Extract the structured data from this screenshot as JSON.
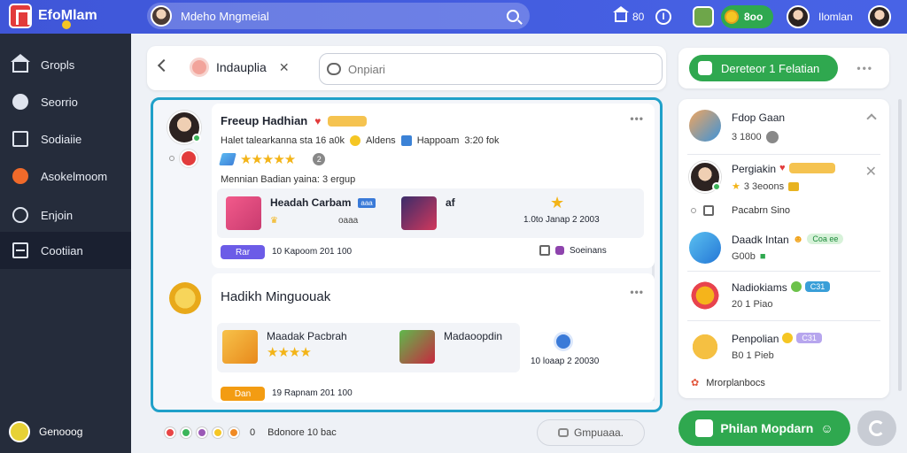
{
  "app": {
    "name": "EfoMlam"
  },
  "topbar": {
    "search_text": "Mdeho Mngmeial",
    "nav_label": "80",
    "info_label": "I",
    "coins_label": "8oo",
    "user_name": "Ilomlan"
  },
  "sidebar": {
    "items": [
      {
        "label": "Gropls",
        "icon": "home-icon"
      },
      {
        "label": "Seorrio",
        "icon": "face-icon"
      },
      {
        "label": "Sodiaiie",
        "icon": "board-icon"
      },
      {
        "label": "Asokelmoom",
        "icon": "emoji-icon"
      },
      {
        "label": "Enjoin",
        "icon": "user-icon"
      },
      {
        "label": "Cootiian",
        "icon": "panel-icon"
      }
    ],
    "footer_label": "Genooog"
  },
  "main": {
    "tab_label": "Indauplia",
    "input_placeholder": "Onpiari",
    "posts": [
      {
        "title": "Freeup Hadhian",
        "badge": "",
        "meta_text": "Halet talearkanna sta 16 a0k",
        "meta_tag1": "Aldens",
        "meta_tag2": "Happoam",
        "meta_time": "3:20 fok",
        "rating_count": "2",
        "description": "Mennian Badian yaina: 3 ergup",
        "rewards": [
          {
            "title": "Headah Carbam",
            "tag": "aaa",
            "sub": "oaaa",
            "extra": ""
          },
          {
            "title": "af",
            "tag": "",
            "sub": "",
            "extra": ""
          }
        ],
        "reward_date": "1.0to Janap 2 2003",
        "action_label": "Rar",
        "action_note": "10 Kapoom 201 100",
        "right_note": "Soeinans"
      },
      {
        "title": "Hadikh Minguouak",
        "rewards": [
          {
            "title": "Maadak Pacbrah",
            "tag": "",
            "sub": "",
            "extra": ""
          },
          {
            "title": "Madaoopdin",
            "tag": "",
            "sub": "",
            "extra": ""
          }
        ],
        "reward_date": "10 loaap 2 20030",
        "action_label": "Dan",
        "action_note": "19 Rapnam 201 100"
      }
    ],
    "footer_text": "Bdonore 10 bac",
    "footer_counter": "0",
    "footer_button": "Gmpuaaa.",
    "reactions": [
      "#e84545",
      "#3cb55a",
      "#9b59b6",
      "#f5c623",
      "#f08a24"
    ]
  },
  "right": {
    "header_button": "Dereteor 1 Felatian",
    "items": [
      {
        "title": "Fdop Gaan",
        "sub": "3 1800",
        "chip": "",
        "chip_style": ""
      },
      {
        "title": "Pergiakin",
        "sub": "3 3eoons",
        "chip": "",
        "chip_style": "yellow"
      },
      {
        "title": "Daadk Intan",
        "sub": "G00b",
        "chip": "Coa ee",
        "chip_style": "green"
      },
      {
        "title": "Nadiokiams",
        "sub": "20 1 Piao",
        "chip": "C31",
        "chip_style": "blue"
      },
      {
        "title": "Penpolian",
        "sub": "B0 1 Pieb",
        "chip": "C31",
        "chip_style": "violet"
      }
    ],
    "line1": "Pacabrn Sino",
    "line2": "Mrorplanbocs",
    "cta_label": "Philan Mopdarn"
  }
}
